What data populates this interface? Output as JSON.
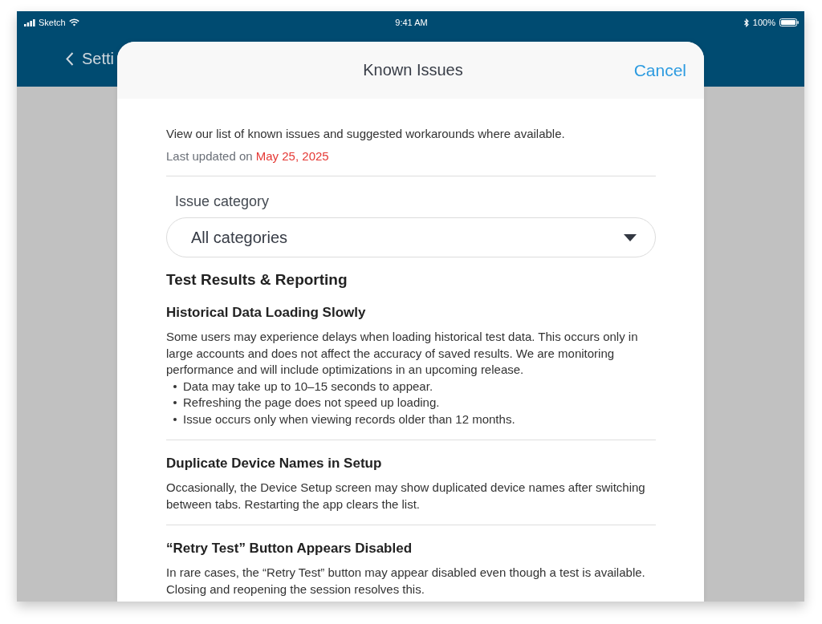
{
  "status_bar": {
    "carrier": "Sketch",
    "time": "9:41 AM",
    "battery": "100%"
  },
  "nav_bar": {
    "back_label": "Setti"
  },
  "modal": {
    "title": "Known Issues",
    "cancel": "Cancel",
    "intro": "View our list of known issues and suggested workarounds where available.",
    "last_updated": {
      "label": "Last updated on",
      "date": "May 25, 2025"
    },
    "category_filter": {
      "label": "Issue category",
      "value": "All categories"
    },
    "sections": [
      {
        "title": "Test Results & Reporting",
        "issues": [
          {
            "title": "Historical Data Loading Slowly",
            "description": "Some users may experience delays when loading historical test data. This occurs only in large accounts and does not affect the accuracy of saved results. We are monitoring performance and will include optimizations in an upcoming release.",
            "bullets": [
              "Data may take up to 10–15 seconds to appear.",
              "Refreshing the page does not speed up loading.",
              "Issue occurs only when viewing records older than 12 months."
            ]
          },
          {
            "title": "Duplicate Device Names in Setup",
            "description": "Occasionally, the Device Setup screen may show duplicated device names after switching between tabs. Restarting the app clears the list."
          },
          {
            "title": "“Retry Test” Button Appears Disabled",
            "description": "In rare cases, the “Retry Test” button may appear disabled even though a test is available. Closing and reopening the session resolves this."
          }
        ]
      }
    ]
  }
}
